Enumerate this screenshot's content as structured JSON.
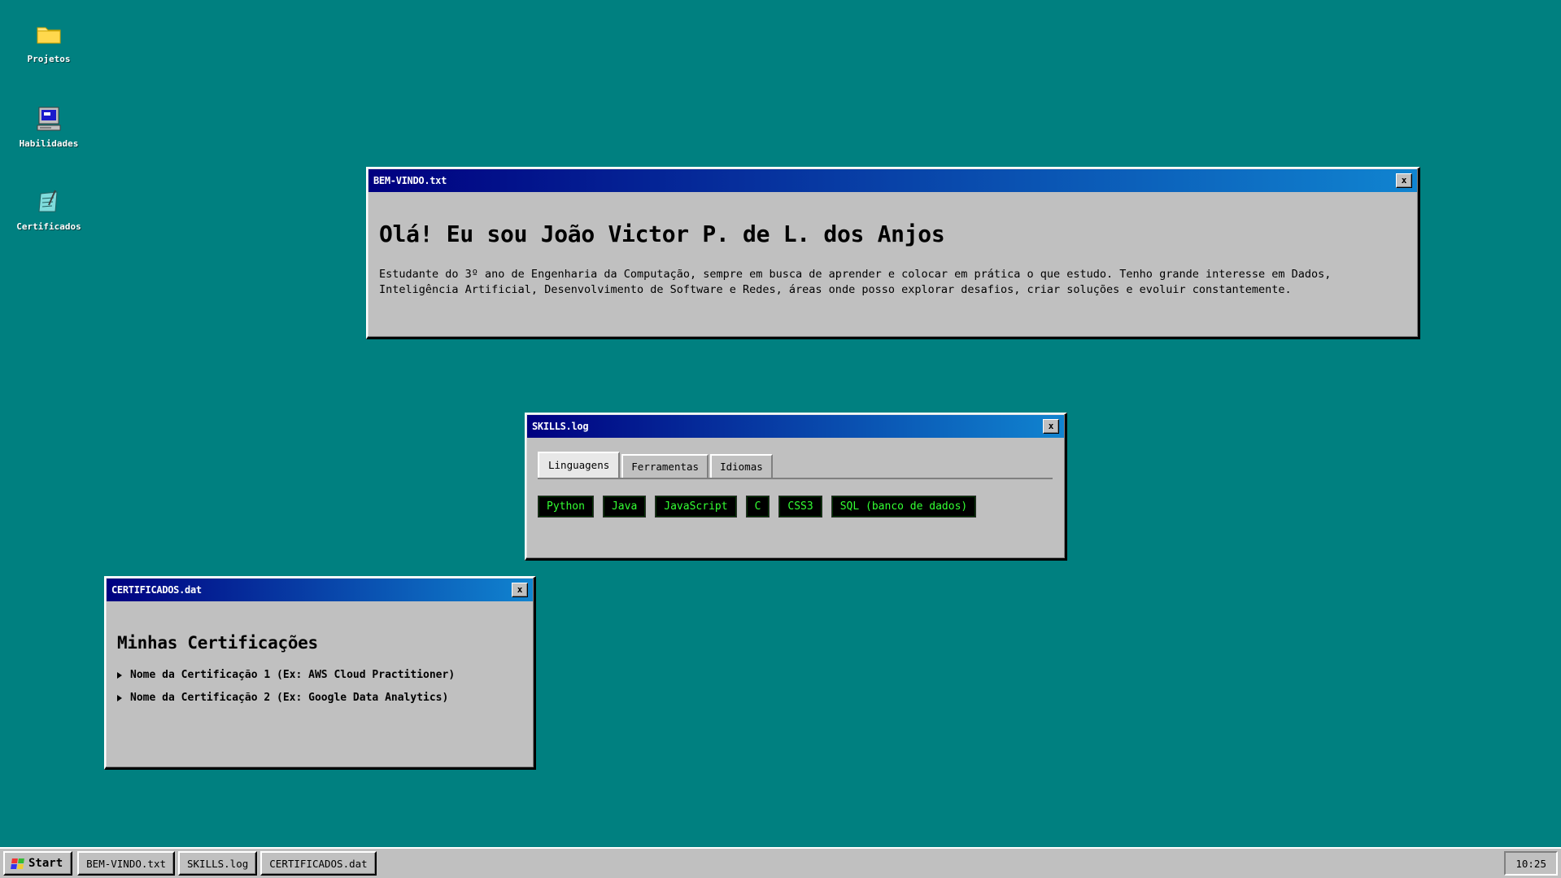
{
  "desktop": {
    "icons": [
      {
        "label": "Projetos",
        "icon": "folder-icon"
      },
      {
        "label": "Habilidades",
        "icon": "computer-icon"
      },
      {
        "label": "Certificados",
        "icon": "notepad-icon"
      }
    ]
  },
  "welcome_window": {
    "title": "BEM-VINDO.txt",
    "close_label": "x",
    "heading": "Olá! Eu sou João Victor P. de L. dos Anjos",
    "body": "Estudante do 3º ano de Engenharia da Computação, sempre em busca de aprender e colocar em prática o que estudo. Tenho grande interesse em Dados, Inteligência Artificial, Desenvolvimento de Software e Redes, áreas onde posso explorar desafios, criar soluções e evoluir constantemente."
  },
  "skills_window": {
    "title": "SKILLS.log",
    "close_label": "x",
    "tabs": [
      {
        "label": "Linguagens",
        "active": true
      },
      {
        "label": "Ferramentas",
        "active": false
      },
      {
        "label": "Idiomas",
        "active": false
      }
    ],
    "chips": [
      "Python",
      "Java",
      "JavaScript",
      "C",
      "CSS3",
      "SQL (banco de dados)"
    ],
    "chip_text_color": "#33ff33",
    "chip_bg_color": "#000000"
  },
  "certs_window": {
    "title": "CERTIFICADOS.dat",
    "close_label": "x",
    "heading": "Minhas Certificações",
    "items": [
      "Nome da Certificação 1 (Ex: AWS Cloud Practitioner)",
      "Nome da Certificação 2 (Ex: Google Data Analytics)"
    ]
  },
  "taskbar": {
    "start_label": "Start",
    "buttons": [
      "BEM-VINDO.txt",
      "SKILLS.log",
      "CERTIFICADOS.dat"
    ],
    "clock": "10:25"
  },
  "colors": {
    "desktop": "#008080",
    "title_gradient_start": "#000080",
    "title_gradient_end": "#1084d0",
    "window_face": "#c0c0c0"
  }
}
